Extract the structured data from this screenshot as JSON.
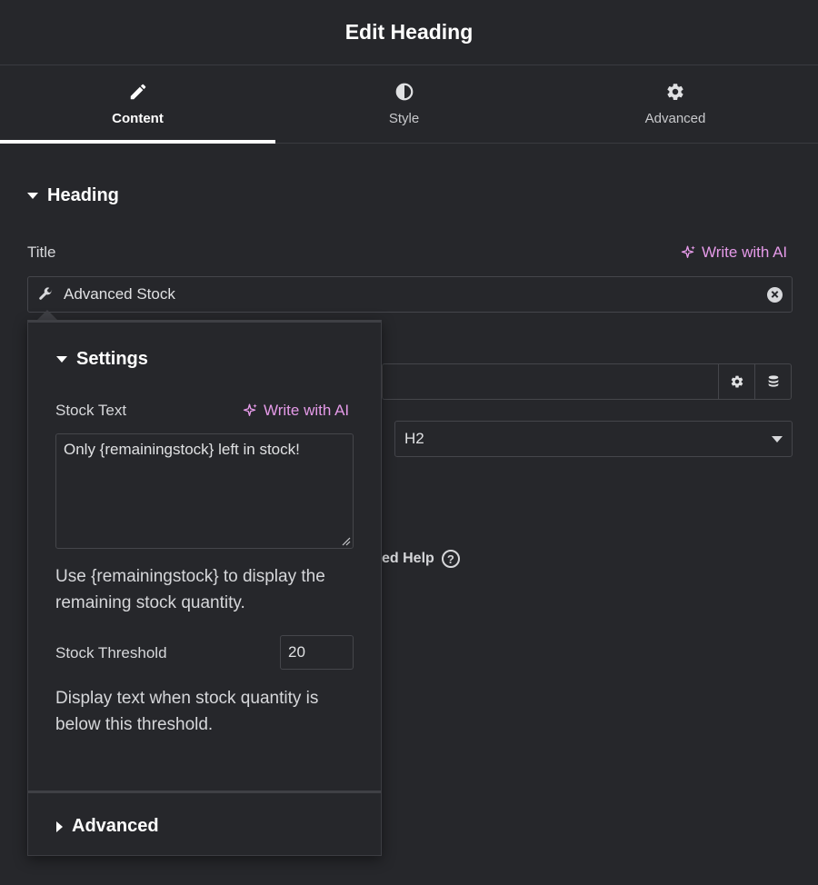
{
  "header": {
    "title": "Edit Heading"
  },
  "tabs": [
    {
      "label": "Content",
      "icon": "pencil-icon",
      "active": true
    },
    {
      "label": "Style",
      "icon": "half-circle-icon",
      "active": false
    },
    {
      "label": "Advanced",
      "icon": "gear-icon",
      "active": false
    }
  ],
  "section": {
    "title": "Heading"
  },
  "title_field": {
    "label": "Title",
    "ai_label": "Write with AI",
    "value": "Advanced Stock"
  },
  "html_tag": {
    "value": "H2"
  },
  "help": {
    "text": "ed Help",
    "icon": "question-circle-icon"
  },
  "popover": {
    "settings_title": "Settings",
    "stock_text_label": "Stock Text",
    "ai_label": "Write with AI",
    "stock_text_value": "Only {remainingstock} left in stock!",
    "stock_text_desc": "Use {remainingstock} to display the remaining stock quantity.",
    "threshold_label": "Stock Threshold",
    "threshold_value": "20",
    "threshold_desc": "Display text when stock quantity is below this threshold.",
    "advanced_title": "Advanced"
  },
  "colors": {
    "accent_ai": "#e59ae8",
    "background": "#26272b"
  }
}
